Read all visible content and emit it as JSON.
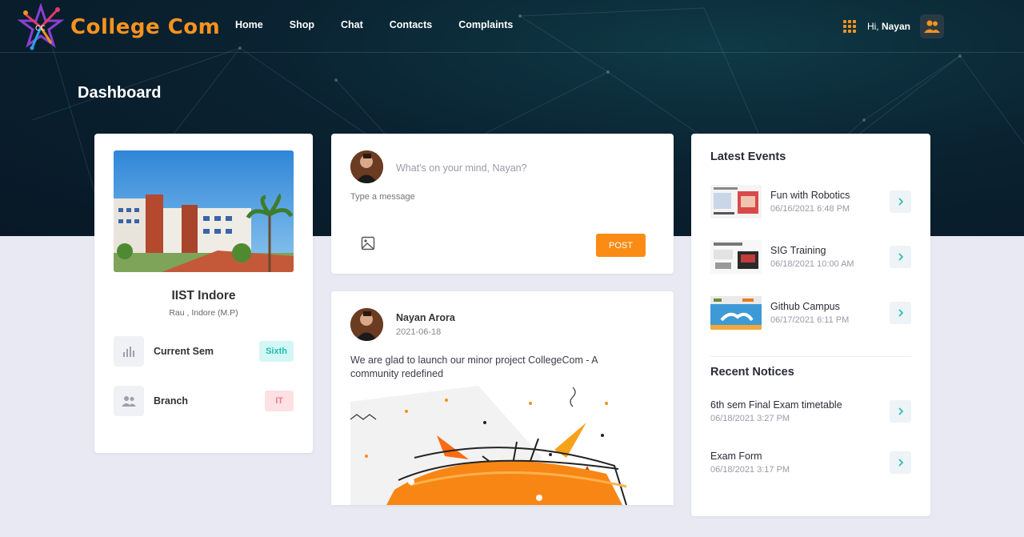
{
  "brand": {
    "name": "College Com",
    "logo_initials": "CC"
  },
  "nav": {
    "links": [
      "Home",
      "Shop",
      "Chat",
      "Contacts",
      "Complaints"
    ],
    "greeting": "Hi,",
    "user_name": "Nayan"
  },
  "page": {
    "title": "Dashboard"
  },
  "profile": {
    "college": "IIST Indore",
    "location": "Rau , Indore (M.P)",
    "current_sem_label": "Current Sem",
    "current_sem_value": "Sixth",
    "branch_label": "Branch",
    "branch_value": "IT"
  },
  "composer": {
    "prompt": "What's on your mind, Nayan?",
    "message_placeholder": "Type a message",
    "post_label": "POST"
  },
  "feed": {
    "author": "Nayan Arora",
    "date": "2021-06-18",
    "text": "We are glad to launch our minor project CollegeCom - A community redefined"
  },
  "events": {
    "title": "Latest Events",
    "items": [
      {
        "title": "Fun with Robotics",
        "date": "06/16/2021 6:48 PM"
      },
      {
        "title": "SIG Training",
        "date": "06/18/2021 10:00 AM"
      },
      {
        "title": "Github Campus",
        "date": "06/17/2021 6:11 PM"
      }
    ]
  },
  "notices": {
    "title": "Recent Notices",
    "items": [
      {
        "title": "6th sem Final Exam timetable",
        "date": "06/18/2021 3:27 PM"
      },
      {
        "title": "Exam Form",
        "date": "06/18/2021 3:17 PM"
      }
    ]
  },
  "colors": {
    "accent": "#fa8c16",
    "brand": "#f7931e",
    "hero_bg": "#0a2231",
    "page_bg": "#e8e9f3"
  }
}
